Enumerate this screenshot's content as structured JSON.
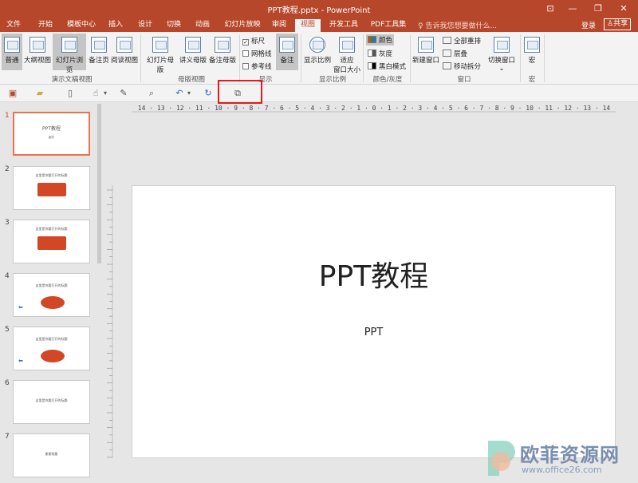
{
  "window": {
    "title": "PPT教程.pptx - PowerPoint",
    "buttons": [
      "⊡",
      "—",
      "❐",
      "✕"
    ]
  },
  "menu": {
    "tabs": [
      "文件",
      "开始",
      "模板中心",
      "插入",
      "设计",
      "切换",
      "动画",
      "幻灯片放映",
      "审阅",
      "视图",
      "开发工具",
      "PDF工具集"
    ],
    "active_tab": "视图",
    "tell_me": "告诉我您想要做什么...",
    "login": "登录",
    "share": "共享"
  },
  "ribbon": {
    "views": {
      "normal": "普通",
      "outline": "大纲视图",
      "sorter": "幻灯片浏览",
      "notes_page": "备注页",
      "reading": "阅读视图",
      "group": "演示文稿视图"
    },
    "master": {
      "slide_master": "幻灯片母版",
      "handout_master": "讲义母版",
      "notes_master": "备注母版",
      "group": "母版视图"
    },
    "show": {
      "ruler": "标尺",
      "gridlines": "网格线",
      "guides": "参考线",
      "notes": "备注",
      "group": "显示",
      "ruler_checked": true,
      "gridlines_checked": false,
      "guides_checked": false
    },
    "zoom": {
      "zoom": "显示比例",
      "fit_line1": "适应",
      "fit_line2": "窗口大小",
      "group": "显示比例"
    },
    "color": {
      "color": "颜色",
      "grayscale": "灰度",
      "bw": "黑白模式",
      "group": "颜色/灰度"
    },
    "window": {
      "new_window": "新建窗口",
      "arrange_all": "全部重排",
      "cascade": "层叠",
      "move_split": "移动拆分",
      "switch_window": "切换窗口",
      "group": "窗口"
    },
    "macros": {
      "macros": "宏",
      "group": "宏"
    }
  },
  "ruler": {
    "horizontal": "16 · 15 · 14 · 13 · 12 · 11 · 10 · 9 · 8 · 7 · 6 · 5 · 4 · 3 · 2 · 1 · 0 · 1 · 2 · 3 · 4 · 5 · 6 · 7 · 8 · 9 · 10 · 11 · 12 · 13 · 14 · 15 · 16"
  },
  "thumbnails": [
    {
      "num": "1",
      "active": true,
      "text": "PPT教程",
      "sub": "PPT",
      "kind": "title"
    },
    {
      "num": "2",
      "active": false,
      "text": "这里是你要打开的标题",
      "kind": "box"
    },
    {
      "num": "3",
      "active": false,
      "text": "这里是你要打开的标题",
      "kind": "box"
    },
    {
      "num": "4",
      "active": false,
      "text": "这里是你要打开的标题",
      "kind": "ellipse"
    },
    {
      "num": "5",
      "active": false,
      "text": "这里是你要打开的标题",
      "kind": "ellipse"
    },
    {
      "num": "6",
      "active": false,
      "text": "这里是你要打开的标题",
      "kind": "text"
    },
    {
      "num": "7",
      "active": false,
      "text": "谢谢观看",
      "kind": "text"
    }
  ],
  "slide": {
    "title": "PPT教程",
    "subtitle": "PPT"
  },
  "watermark": {
    "text": "欧菲资源网",
    "url": "www.office26.com"
  },
  "colors": {
    "accent": "#b7472a",
    "highlight": "#e01b1b"
  }
}
